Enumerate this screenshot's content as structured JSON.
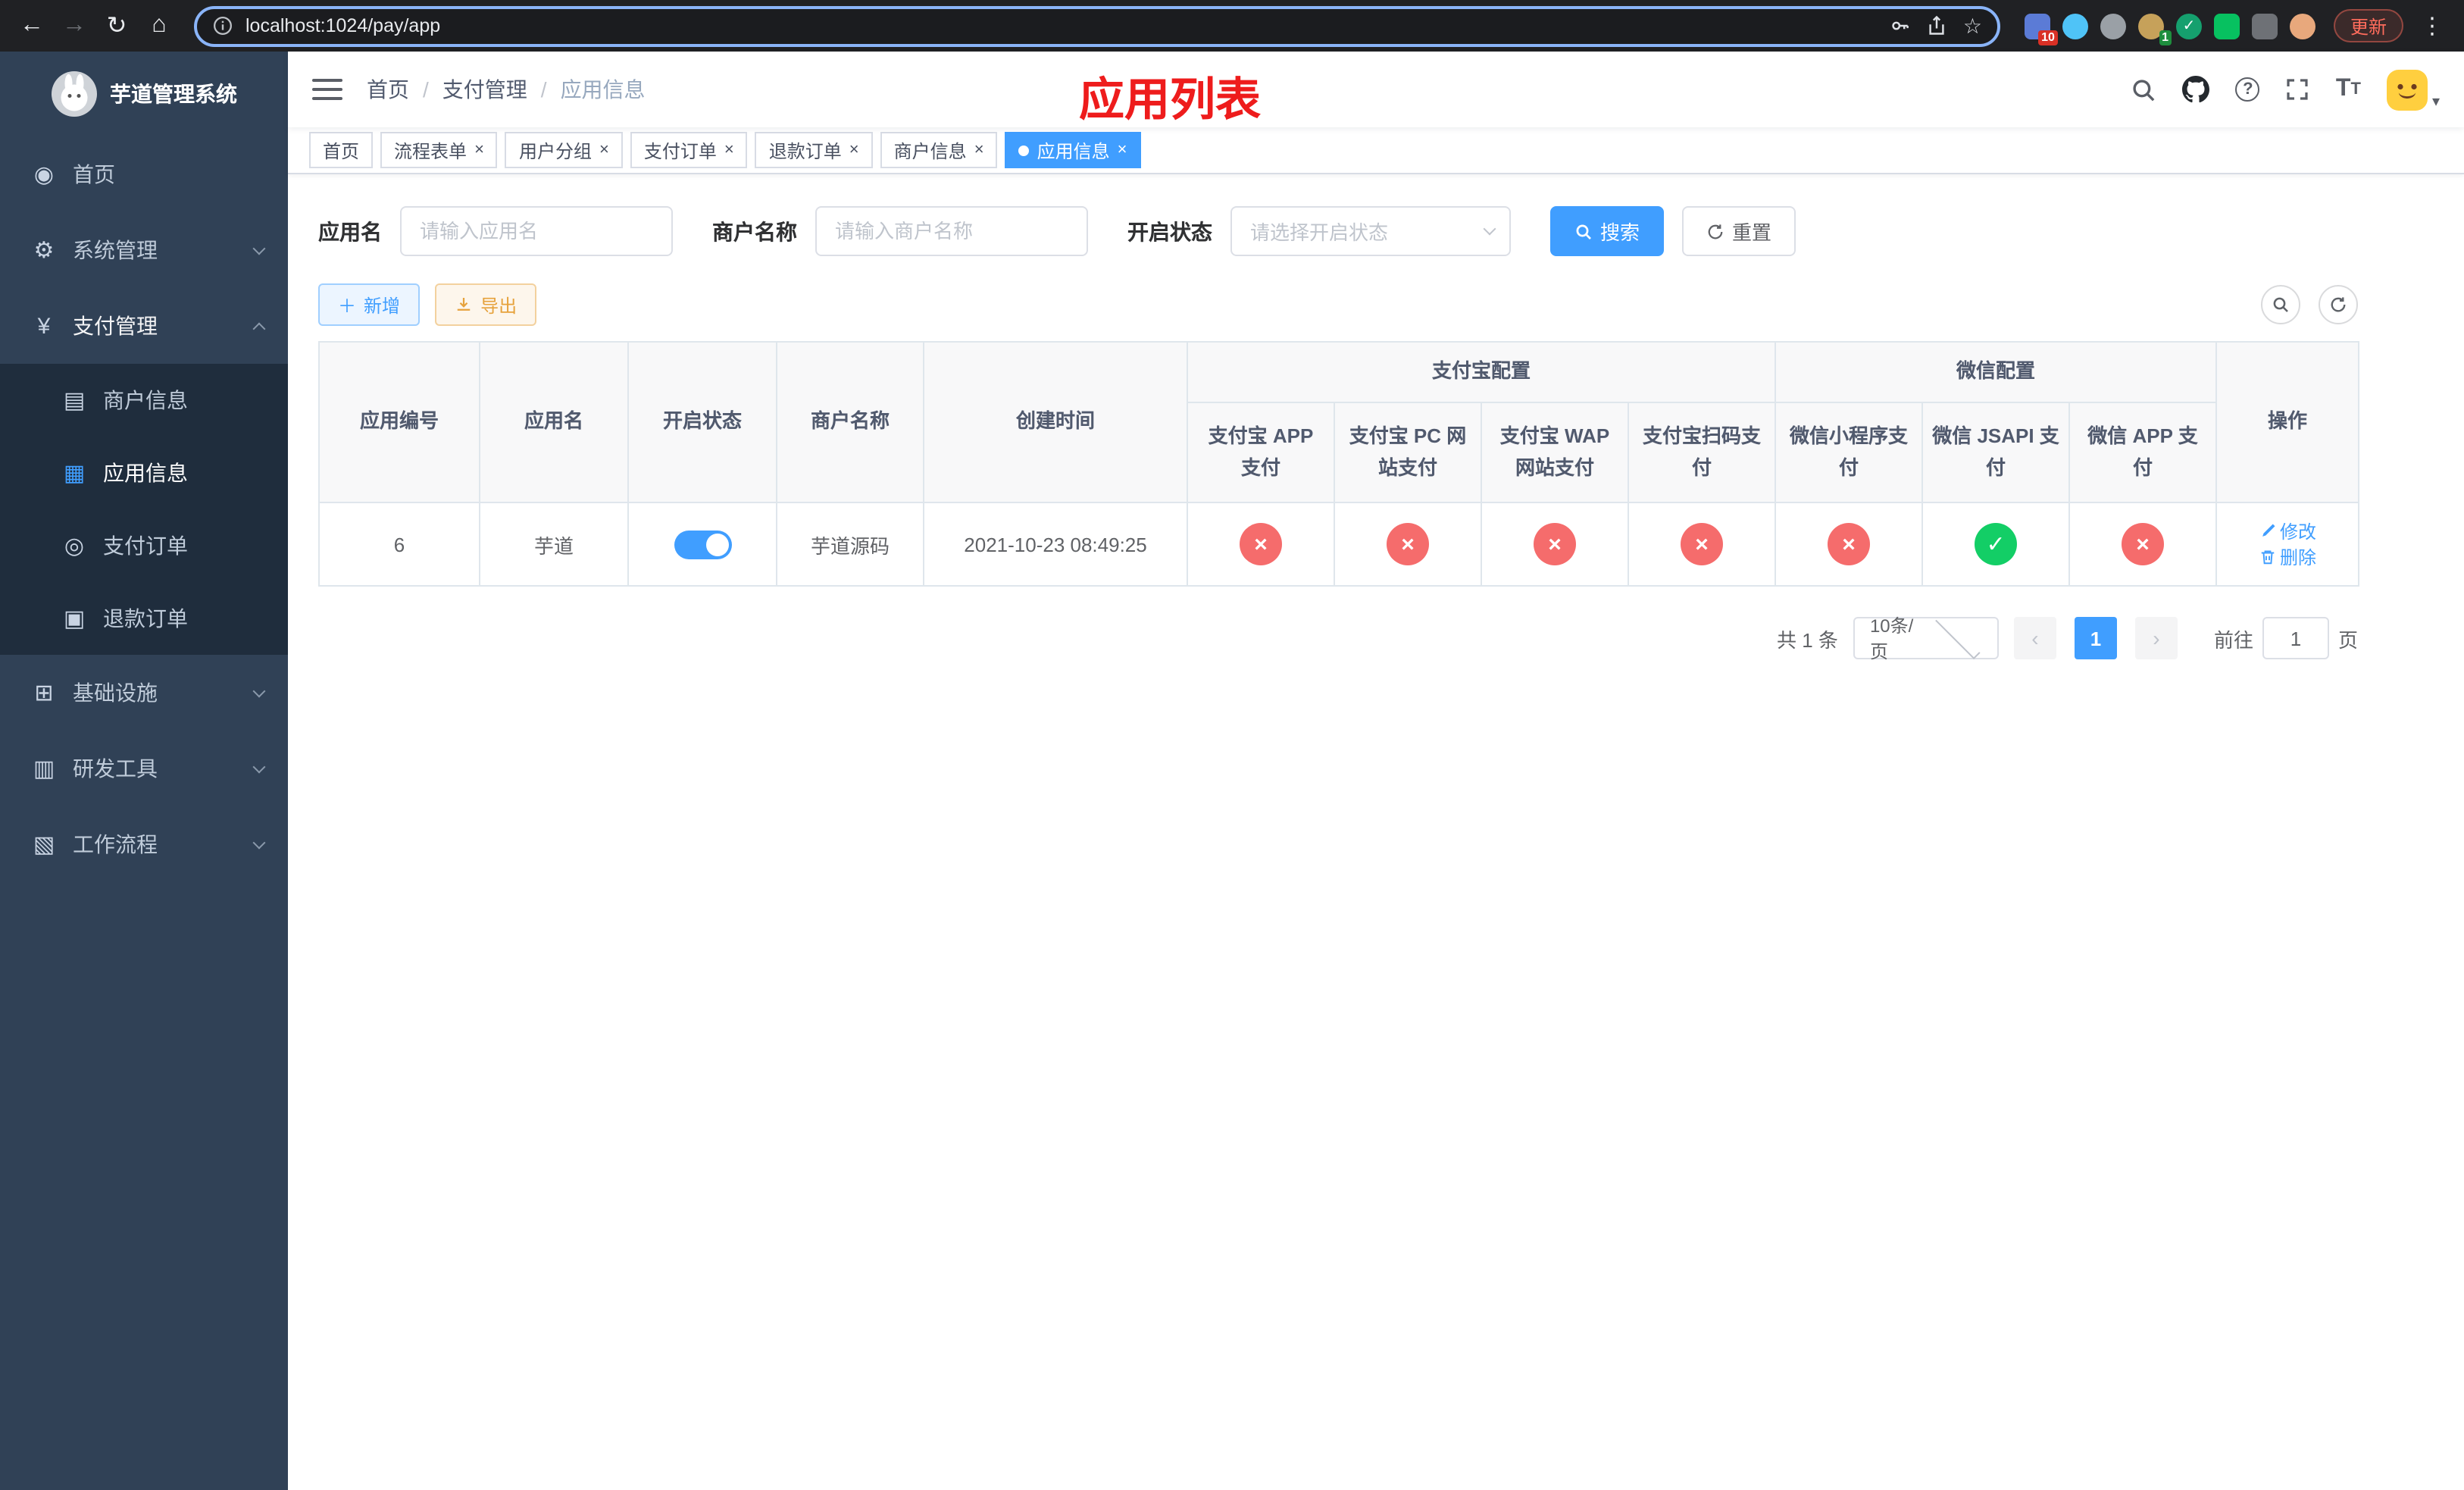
{
  "colors": {
    "primary": "#409eff",
    "danger": "#f56c6c",
    "success": "#13ce66",
    "annotation_red": "#ee1c1c",
    "sidebar_bg": "#304156",
    "submenu_bg": "#1f2d3d"
  },
  "browser": {
    "url": "localhost:1024/pay/app",
    "update_button": "更新",
    "extension_badge_count": "10",
    "avatar_badge_count": "1"
  },
  "sidebar": {
    "logo_title": "芋道管理系统",
    "items": [
      {
        "label": "首页"
      },
      {
        "label": "系统管理"
      },
      {
        "label": "支付管理"
      },
      {
        "label": "商户信息"
      },
      {
        "label": "应用信息"
      },
      {
        "label": "支付订单"
      },
      {
        "label": "退款订单"
      },
      {
        "label": "基础设施"
      },
      {
        "label": "研发工具"
      },
      {
        "label": "工作流程"
      }
    ]
  },
  "header": {
    "breadcrumb": [
      "首页",
      "支付管理",
      "应用信息"
    ],
    "overlay_title": "应用列表"
  },
  "tabs": [
    {
      "label": "首页"
    },
    {
      "label": "流程表单"
    },
    {
      "label": "用户分组"
    },
    {
      "label": "支付订单"
    },
    {
      "label": "退款订单"
    },
    {
      "label": "商户信息"
    },
    {
      "label": "应用信息"
    }
  ],
  "filters": {
    "app_name_label": "应用名",
    "app_name_placeholder": "请输入应用名",
    "merchant_label": "商户名称",
    "merchant_placeholder": "请输入商户名称",
    "status_label": "开启状态",
    "status_placeholder": "请选择开启状态",
    "search_button": "搜索",
    "reset_button": "重置"
  },
  "toolbar": {
    "add_button": "新增",
    "export_button": "导出"
  },
  "table": {
    "groups": {
      "alipay": "支付宝配置",
      "wechat": "微信配置"
    },
    "columns": [
      "应用编号",
      "应用名",
      "开启状态",
      "商户名称",
      "创建时间",
      "支付宝 APP 支付",
      "支付宝 PC 网站支付",
      "支付宝 WAP 网站支付",
      "支付宝扫码支付",
      "微信小程序支付",
      "微信 JSAPI 支付",
      "微信 APP 支付",
      "操作"
    ],
    "rows": [
      {
        "id": "6",
        "name": "芋道",
        "enabled": true,
        "merchant": "芋道源码",
        "created": "2021-10-23 08:49:25",
        "alipay_app": false,
        "alipay_pc": false,
        "alipay_wap": false,
        "alipay_qr": false,
        "wx_mini": false,
        "wx_jsapi": true,
        "wx_app": false,
        "edit_label": "修改",
        "delete_label": "删除"
      }
    ]
  },
  "pagination": {
    "total": "共 1 条",
    "page_size": "10条/页",
    "current_page": "1",
    "goto_label": "前往",
    "goto_value": "1",
    "page_unit": "页"
  }
}
